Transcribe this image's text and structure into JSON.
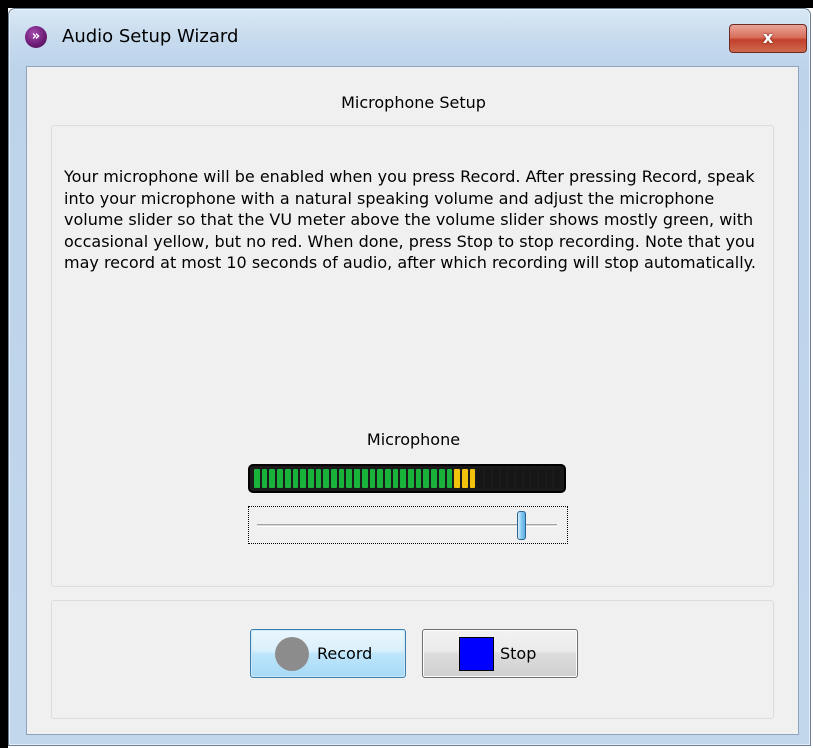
{
  "window": {
    "title": "Audio Setup Wizard",
    "close_label": "x",
    "icon": "app-logo-icon"
  },
  "header": {
    "title": "Microphone Setup"
  },
  "instructions": "Your microphone will be enabled when you press Record. After pressing Record, speak into your microphone with a natural speaking volume and adjust the microphone volume slider so that the VU meter above the volume slider shows mostly green, with occasional yellow, but no red. When done, press Stop to stop recording. Note that you may record at most 10 seconds of audio, after which recording will stop automatically.",
  "microphone": {
    "label": "Microphone",
    "vu_meter": {
      "segments_total": 40,
      "green_segments": 26,
      "yellow_segments": 3,
      "level_fraction": 0.725
    },
    "volume_slider": {
      "value_fraction": 0.88
    }
  },
  "buttons": {
    "record": {
      "label": "Record",
      "icon": "record-circle-icon"
    },
    "stop": {
      "label": "Stop",
      "icon": "stop-square-icon"
    }
  },
  "colors": {
    "vu_green": "#19b23a",
    "vu_yellow": "#f3c20d",
    "vu_off": "#161616",
    "stop_icon": "#0000ff",
    "record_icon": "#8c8c8c",
    "close_button": "#c2412b"
  }
}
